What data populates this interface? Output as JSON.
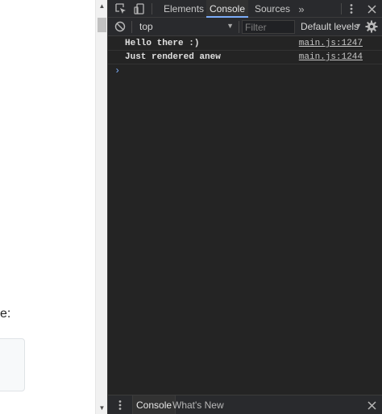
{
  "page": {
    "partial_text": "e:"
  },
  "devtools": {
    "tabs": {
      "elements": "Elements",
      "console": "Console",
      "sources": "Sources"
    },
    "icons": {
      "inspect": "inspect-element-icon",
      "device": "device-toolbar-icon",
      "more_tabs": "chevron-double-right-icon",
      "menu": "kebab-menu-icon",
      "close": "close-icon",
      "clear": "clear-console-icon",
      "settings": "gear-icon"
    },
    "console_toolbar": {
      "context": "top",
      "filter_placeholder": "Filter",
      "levels": "Default levels"
    },
    "messages": [
      {
        "text": "Hello there :)",
        "source": "main.js:1247"
      },
      {
        "text": "Just rendered anew",
        "source": "main.js:1244"
      }
    ],
    "drawer": {
      "console_tab": "Console",
      "whats_new_tab": "What's New"
    }
  },
  "colors": {
    "panel_bg": "#242424",
    "toolbar_bg": "#292a2d",
    "accent": "#7cacf8"
  }
}
